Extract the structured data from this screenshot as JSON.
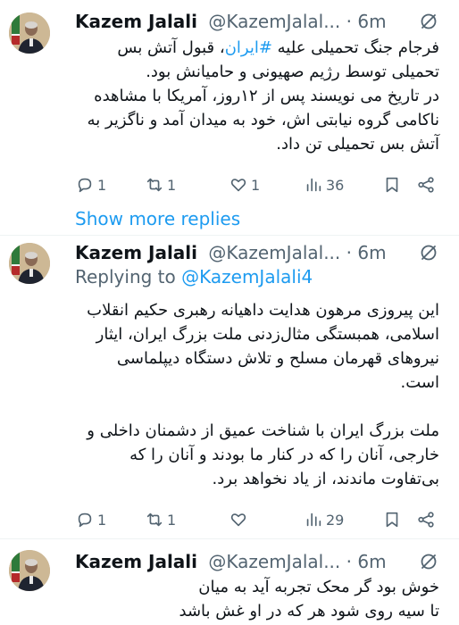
{
  "tweets": [
    {
      "author_name": "Kazem Jalali",
      "handle": "@KazemJalal...",
      "separator": "·",
      "time": "6m",
      "body_pre": "فرجام جنگ تحمیلی علیه ",
      "hashtag": "#ایران",
      "body_post": "، قبول آتش بس تحمیلی توسط رژیم صهیونی و حامیانش بود.\nدر تاریخ می نویسند پس از ۱۲روز، آمریکا با مشاهده ناکامی گروه نیابتی اش، خود به میدان آمد و ناگزیر به آتش بس تحمیلی تن داد.",
      "reply_count": "1",
      "retweet_count": "1",
      "like_count": "1",
      "view_count": "36"
    },
    {
      "author_name": "Kazem Jalali",
      "handle": "@KazemJalal...",
      "separator": "·",
      "time": "6m",
      "replying_label": "Replying to",
      "replying_handle": "@KazemJalali4",
      "body": "این پیروزی مرهون هدایت داهیانه رهبری حکیم انقلاب اسلامی، همبستگی مثال‌زدنی ملت بزرگ ایران، ایثار نیروهای قهرمان مسلح و تلاش دستگاه دیپلماسی است.\n\nملت بزرگ ایران با شناخت عمیق از دشمنان داخلی و خارجی، آنان را که در کنار ما بودند و آنان را که بی‌تفاوت ماندند، از یاد نخواهد برد.",
      "reply_count": "1",
      "retweet_count": "1",
      "like_count": "",
      "view_count": "29"
    },
    {
      "author_name": "Kazem Jalali",
      "handle": "@KazemJalal...",
      "separator": "·",
      "time": "6m",
      "body": "خوش بود گر محک تجربه آید به میان\nتا سیه روی شود هر که در او غش باشد"
    }
  ],
  "show_more_replies": "Show more replies",
  "colors": {
    "accent": "#1d9bf0",
    "text": "#0f1419",
    "muted": "#536471",
    "border": "#eff3f4"
  },
  "icons": [
    "avatar",
    "grok-icon",
    "reply-icon",
    "retweet-icon",
    "like-icon",
    "views-icon",
    "bookmark-icon",
    "share-icon"
  ]
}
